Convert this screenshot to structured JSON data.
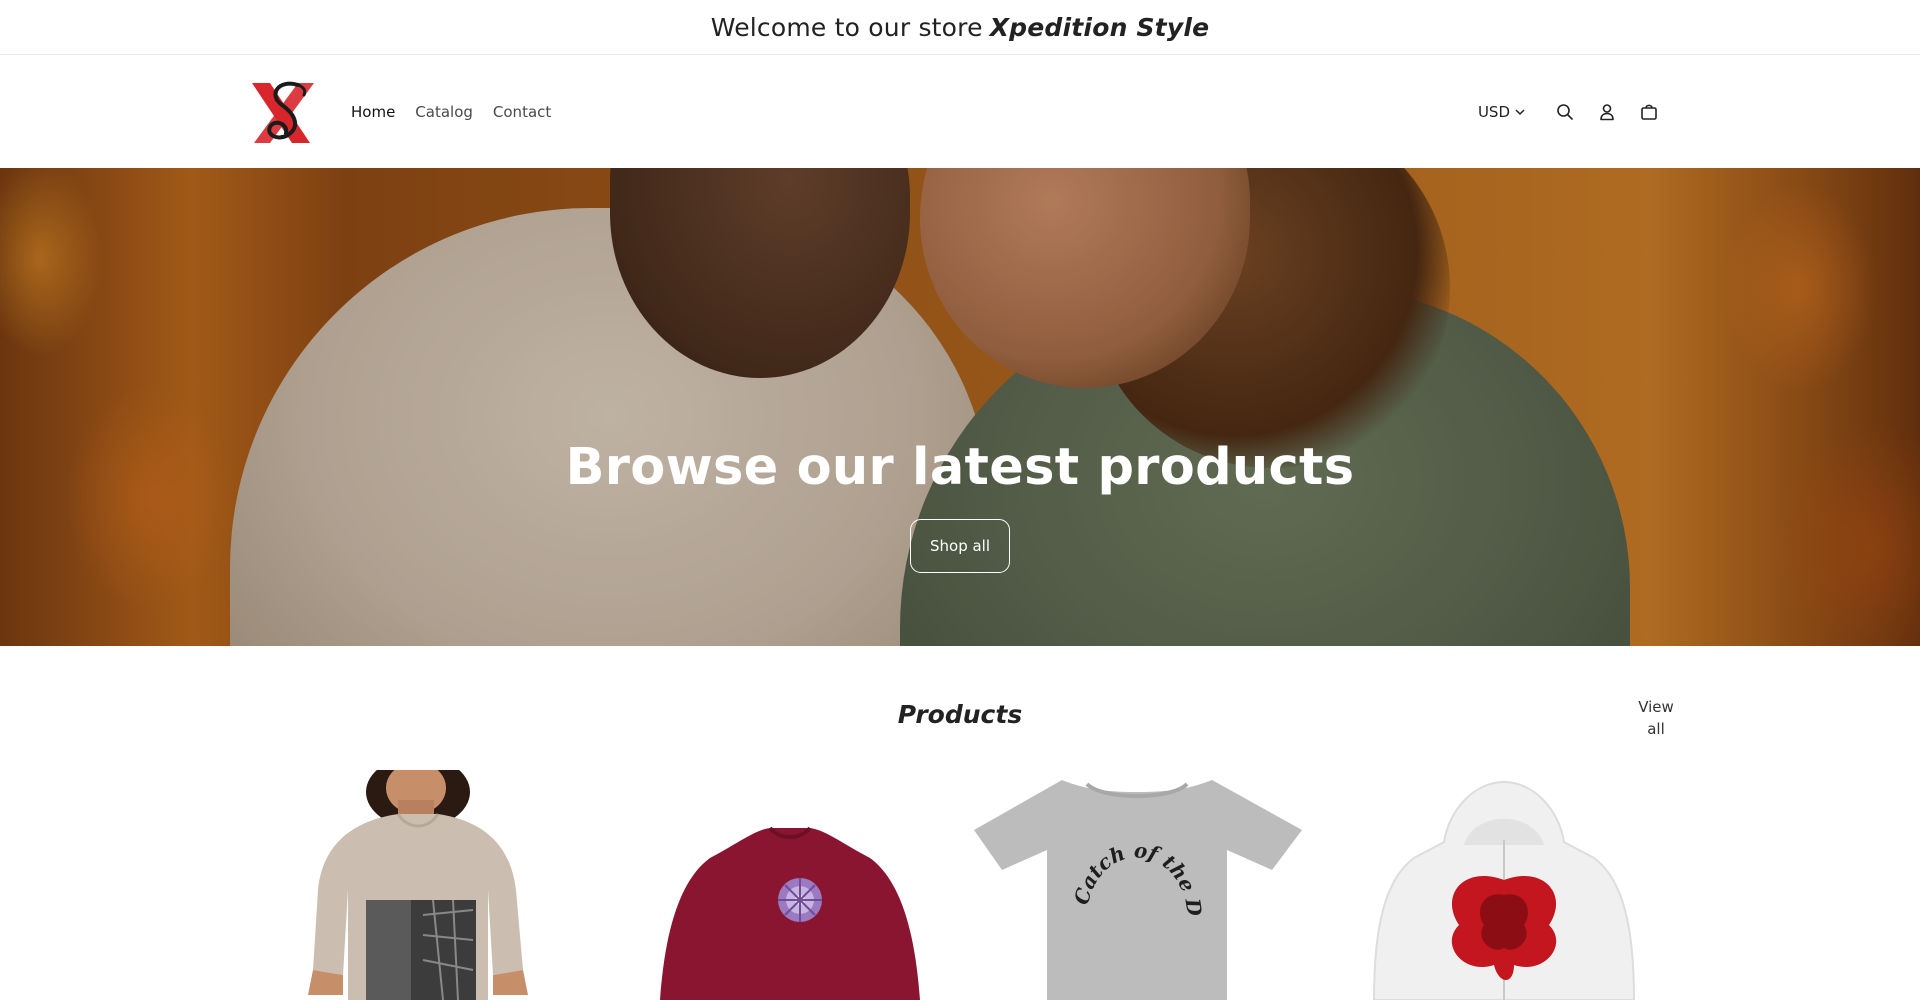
{
  "announcement": {
    "prefix": "Welcome to our store",
    "brand": "Xpedition Style"
  },
  "header": {
    "nav": [
      {
        "label": "Home"
      },
      {
        "label": "Catalog"
      },
      {
        "label": "Contact"
      }
    ],
    "currency": "USD",
    "icons": [
      "search-icon",
      "account-icon",
      "cart-icon"
    ]
  },
  "hero": {
    "title": "Browse our latest products",
    "button_label": "Shop all"
  },
  "products": {
    "title": "Products",
    "view_all_line1": "View",
    "view_all_line2": "all",
    "items": [
      {
        "image": "tshirt-sand-architecture-print"
      },
      {
        "image": "sweatshirt-maroon-flower"
      },
      {
        "image": "tshirt-grey-catch-of-the-day"
      },
      {
        "image": "hoodie-white-red-flower"
      }
    ],
    "card3_print": "Catch of the Day"
  },
  "colors": {
    "logo_red": "#d8262c",
    "logo_black": "#1b1b1b",
    "maroon": "#8a1530",
    "heather_grey": "#b9b9b9"
  }
}
